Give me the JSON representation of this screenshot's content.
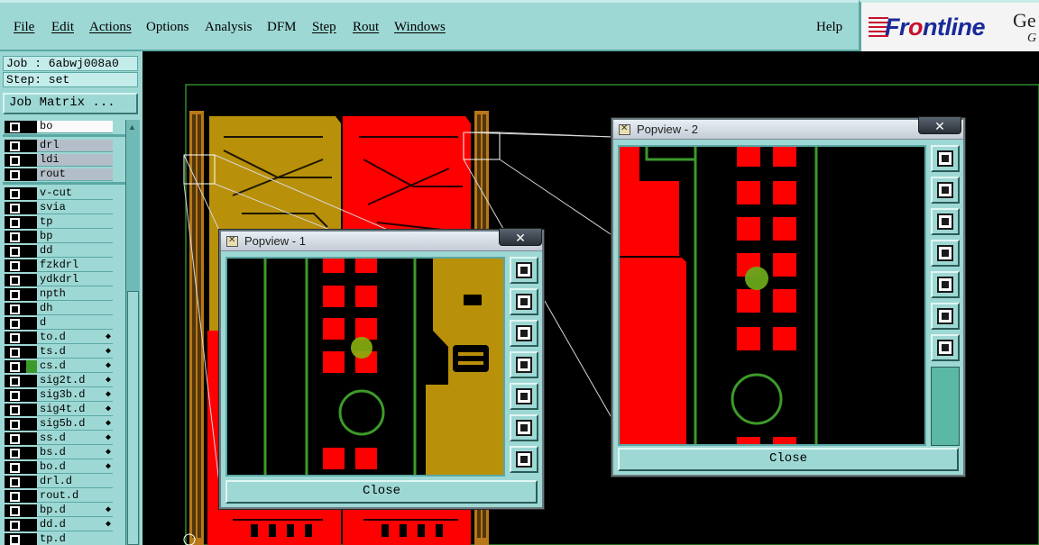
{
  "menubar": {
    "items": [
      {
        "label": "File",
        "underline": true
      },
      {
        "label": "Edit",
        "underline": true
      },
      {
        "label": "Actions",
        "underline": true
      },
      {
        "label": "Options",
        "underline": false
      },
      {
        "label": "Analysis",
        "underline": false
      },
      {
        "label": "DFM",
        "underline": false
      },
      {
        "label": "Step",
        "underline": true
      },
      {
        "label": "Rout",
        "underline": true
      },
      {
        "label": "Windows",
        "underline": true
      }
    ],
    "help": "Help"
  },
  "logo": {
    "brand_pre": "Fr",
    "brand_o": "o",
    "brand_post": "ntline",
    "ge": "Ge",
    "g2": "G"
  },
  "leftpanel": {
    "job": "Job : 6abwj008a0",
    "step": "Step: set",
    "job_matrix": "Job Matrix ..."
  },
  "layers": [
    {
      "name": "bo",
      "style": "white"
    },
    {
      "name": "drl",
      "style": "grey"
    },
    {
      "name": "ldi",
      "style": "grey"
    },
    {
      "name": "rout",
      "style": "grey"
    },
    {
      "name": "v-cut"
    },
    {
      "name": "svia"
    },
    {
      "name": "tp"
    },
    {
      "name": "bp"
    },
    {
      "name": "dd"
    },
    {
      "name": "fzkdrl"
    },
    {
      "name": "ydkdrl"
    },
    {
      "name": "npth"
    },
    {
      "name": "dh"
    },
    {
      "name": "d"
    },
    {
      "name": "to.d",
      "arrow": true
    },
    {
      "name": "ts.d",
      "arrow": true
    },
    {
      "name": "cs.d",
      "arrow": true,
      "mark": "green"
    },
    {
      "name": "sig2t.d",
      "arrow": true
    },
    {
      "name": "sig3b.d",
      "arrow": true
    },
    {
      "name": "sig4t.d",
      "arrow": true
    },
    {
      "name": "sig5b.d",
      "arrow": true
    },
    {
      "name": "ss.d",
      "arrow": true
    },
    {
      "name": "bs.d",
      "arrow": true
    },
    {
      "name": "bo.d",
      "arrow": true
    },
    {
      "name": "drl.d"
    },
    {
      "name": "rout.d"
    },
    {
      "name": "bp.d",
      "arrow": true
    },
    {
      "name": "dd.d",
      "arrow": true
    },
    {
      "name": "tp.d"
    }
  ],
  "popview1": {
    "title": "Popview - 1",
    "close": "Close",
    "close_x": "✕"
  },
  "popview2": {
    "title": "Popview - 2",
    "close": "Close",
    "close_x": "✕"
  },
  "colors": {
    "copper_red": "#ff0000",
    "copper_gold": "#b8900a",
    "outline_green": "#3c9a2a",
    "ui_teal": "#9ed8d4"
  },
  "icons": [
    "zoom-home-icon",
    "pan-up-icon",
    "pan-down-icon",
    "pan-left-icon",
    "pan-right-icon",
    "zoom-in-icon",
    "zoom-out-icon"
  ]
}
